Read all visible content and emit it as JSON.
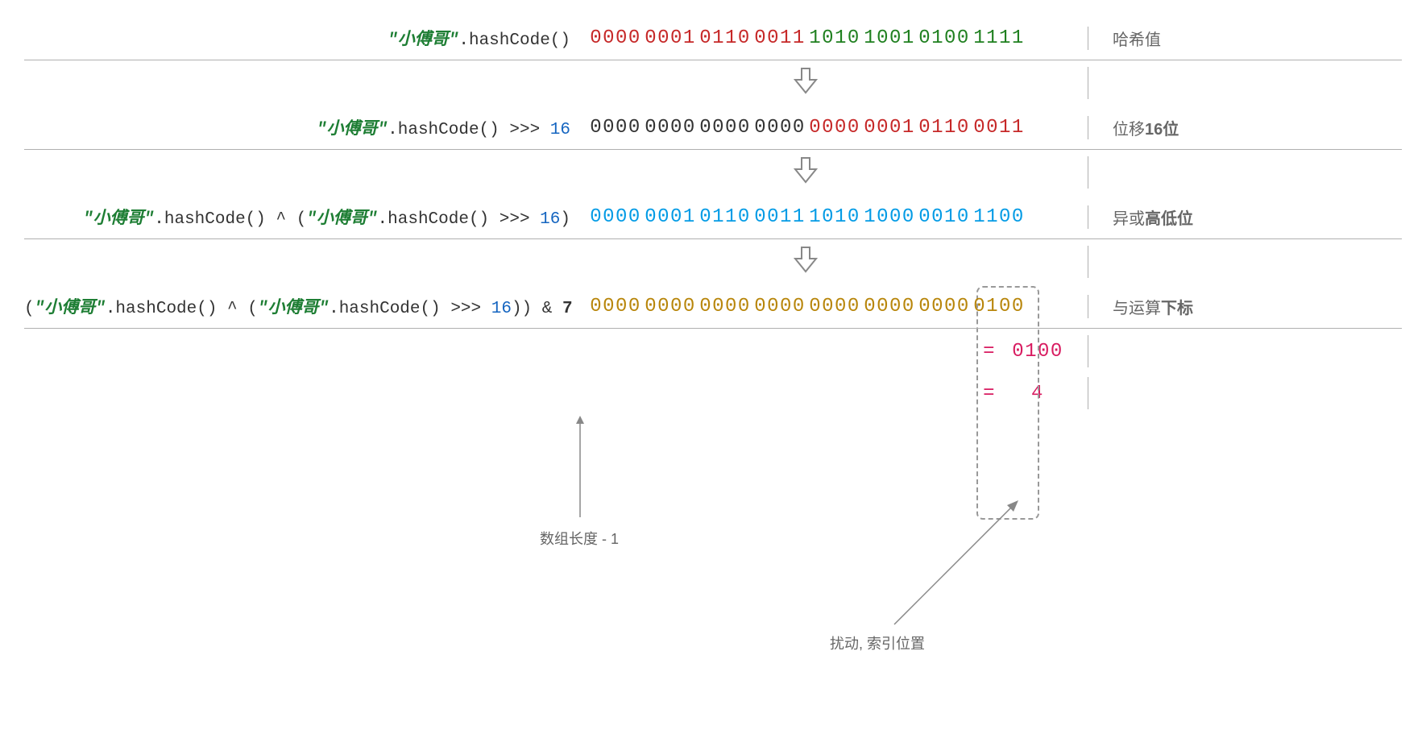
{
  "string_literal": "\"小傅哥\"",
  "method": ".hashCode()",
  "shift_op": " >>> ",
  "shift_amt": "16",
  "and_op": " & ",
  "and_val": "7",
  "xor_op": " ^ ",
  "labels": {
    "row1": "哈希值",
    "row2_pre": "位移",
    "row2_bold": "16位",
    "row3_pre": "异或",
    "row3_bold": "高低位",
    "row4_pre": "与运算",
    "row4_bold": "下标"
  },
  "bits": {
    "r1_hi": [
      "0000",
      "0001",
      "0110",
      "0011"
    ],
    "r1_lo": [
      "1010",
      "1001",
      "0100",
      "1111"
    ],
    "r2_hi": [
      "0000",
      "0000",
      "0000",
      "0000"
    ],
    "r2_lo": [
      "0000",
      "0001",
      "0110",
      "0011"
    ],
    "r3": [
      "0000",
      "0001",
      "0110",
      "0011",
      "1010",
      "1000",
      "0010",
      "1100"
    ],
    "r4": [
      "0000",
      "0000",
      "0000",
      "0000",
      "0000",
      "0000",
      "0000",
      "0100"
    ]
  },
  "result": {
    "eq": "=",
    "bin": "0100",
    "dec": "4"
  },
  "annotations": {
    "array_len": "数组长度 - 1",
    "perturb": "扰动, 索引位置"
  }
}
